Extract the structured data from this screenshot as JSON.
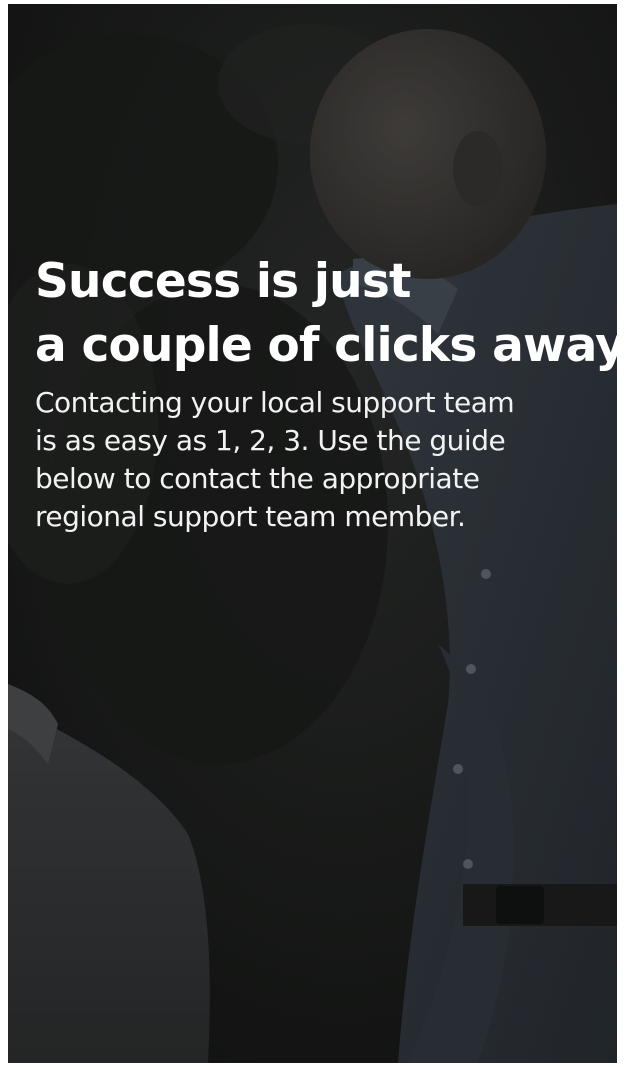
{
  "hero": {
    "title_lines": [
      "Success is just",
      "a couple of clicks away"
    ],
    "body_lines": [
      "Contacting your local support team",
      "is as easy as 1, 2, 3.  Use the guide",
      "below to contact the appropriate",
      "regional support team member."
    ]
  },
  "colors": {
    "overlay": "#1c1d1c",
    "text": "#ffffff",
    "shirt": "#3a4048"
  }
}
